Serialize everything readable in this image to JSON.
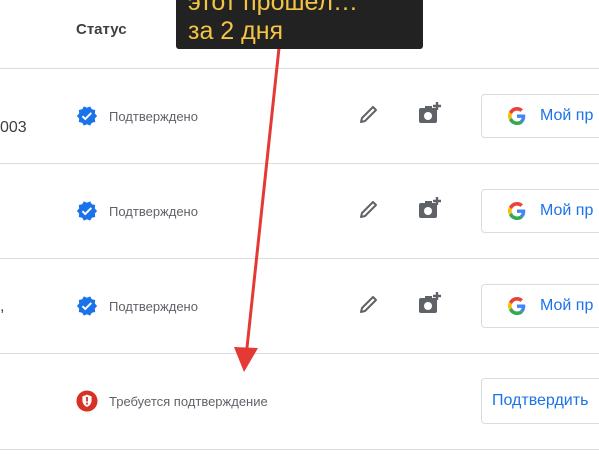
{
  "header": {
    "status_label": "Статус"
  },
  "annotation": {
    "line1": "этот прошёл…",
    "line2": "за 2 дня"
  },
  "rows": [
    {
      "left_text": "003",
      "status": "Подтверждено",
      "status_icon": "verified-check-icon",
      "action_label": "Мой пр"
    },
    {
      "left_text": "",
      "status": "Подтверждено",
      "status_icon": "verified-check-icon",
      "action_label": "Мой пр"
    },
    {
      "left_text": ",",
      "status": "Подтверждено",
      "status_icon": "verified-check-icon",
      "action_label": "Мой пр"
    },
    {
      "left_text": "",
      "status": "Требуется подтверждение",
      "status_icon": "alert-shield-icon",
      "action_label": "Подтвердить"
    }
  ],
  "colors": {
    "verified": "#1a73e8",
    "alert": "#d93025",
    "link": "#1a73e8",
    "annotation_bg": "#222222",
    "annotation_text": "#f4c542",
    "arrow": "#e53935"
  }
}
